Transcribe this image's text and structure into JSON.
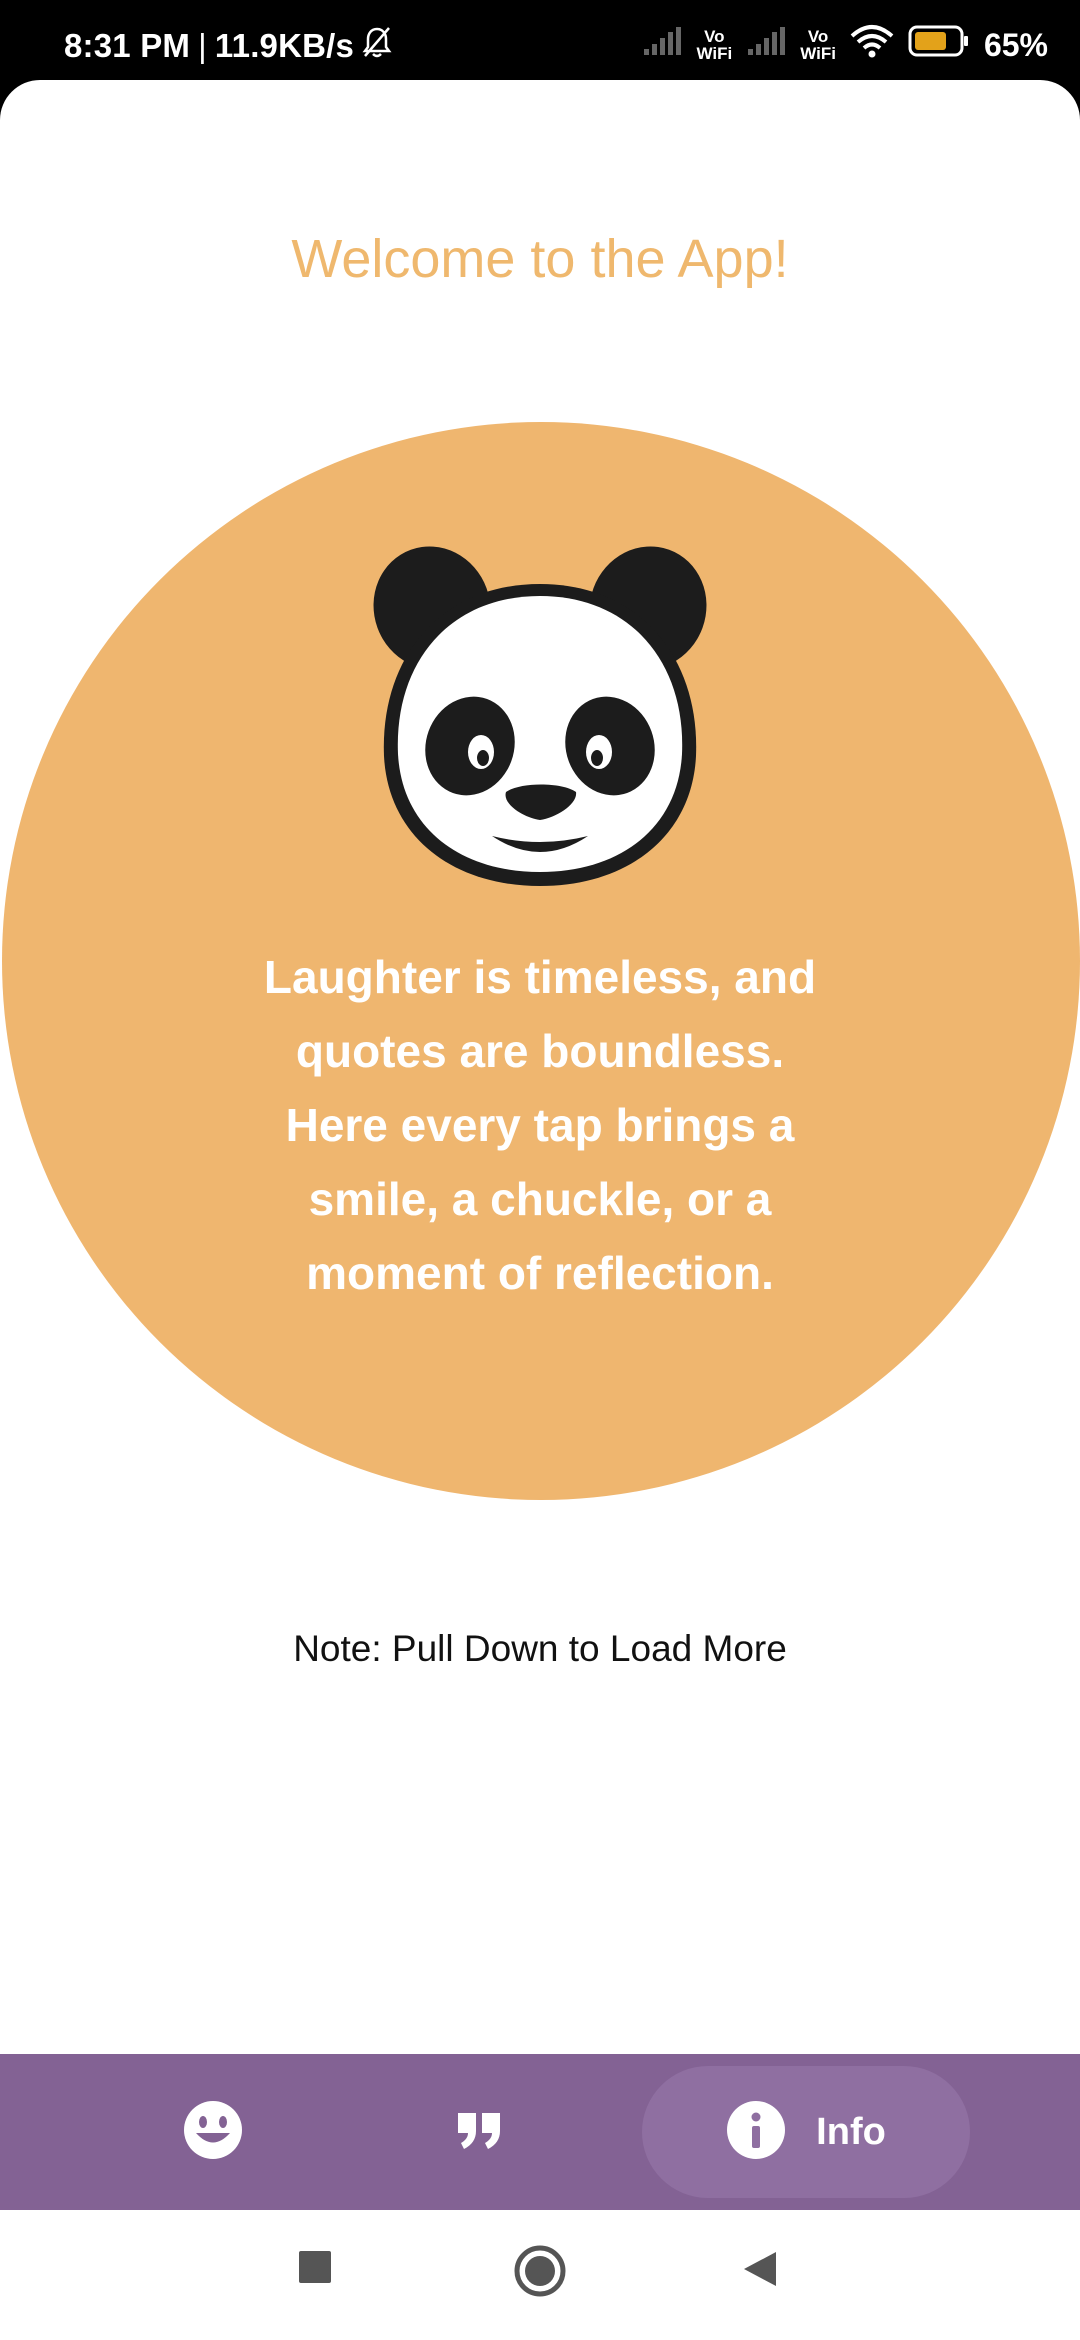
{
  "status_bar": {
    "time": "8:31 PM",
    "separator": "|",
    "net_speed": "11.9KB/s",
    "vowifi_1": "Vo\nWiFi",
    "vowifi_2": "Vo\nWiFi",
    "battery_percent": "65%"
  },
  "main": {
    "welcome_title": "Welcome to the App!",
    "quote": "Laughter is timeless, and quotes are boundless. Here every tap brings a smile, a chuckle, or a moment of reflection.",
    "note": "Note: Pull Down to Load More"
  },
  "bottom_nav": {
    "items": [
      {
        "icon": "smiley-icon",
        "label": ""
      },
      {
        "icon": "quote-icon",
        "label": ""
      },
      {
        "icon": "info-icon",
        "label": "Info"
      }
    ]
  },
  "colors": {
    "accent_orange": "#EFB66F",
    "nav_purple": "#836294",
    "nav_active_pill": "#8F6FA1"
  }
}
